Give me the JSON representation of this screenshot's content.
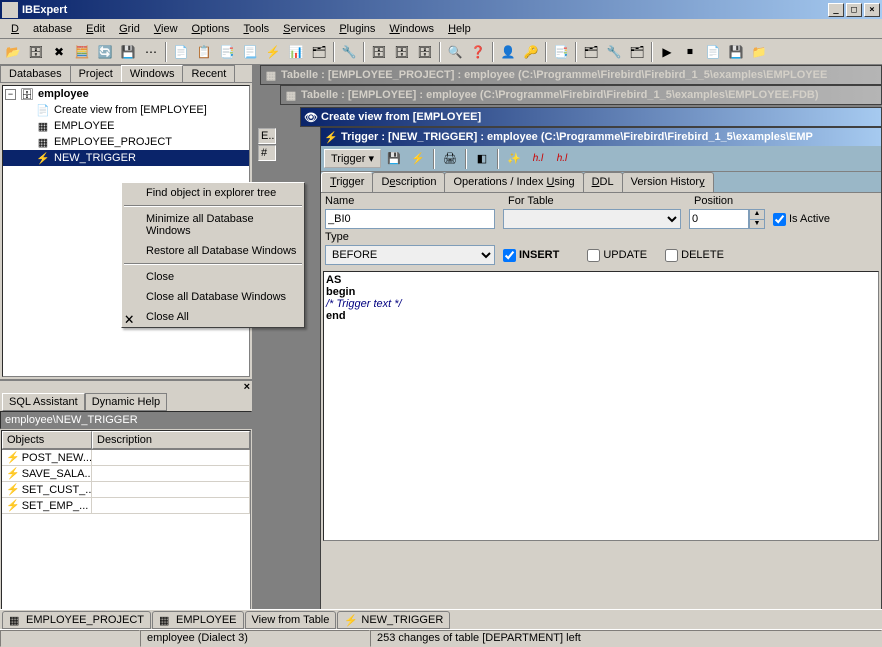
{
  "app": {
    "title": "IBExpert"
  },
  "menu": [
    "Database",
    "Edit",
    "Grid",
    "View",
    "Options",
    "Tools",
    "Services",
    "Plugins",
    "Windows",
    "Help"
  ],
  "left_tabs": [
    "Databases",
    "Project",
    "Windows",
    "Recent"
  ],
  "left_tab_active": 2,
  "tree": {
    "root": "employee",
    "items": [
      "Create view from [EMPLOYEE]",
      "EMPLOYEE",
      "EMPLOYEE_PROJECT",
      "NEW_TRIGGER"
    ],
    "selected": 3
  },
  "ctx": {
    "items": [
      "Find object in explorer tree",
      "-",
      "Minimize all Database Windows",
      "Restore all Database Windows",
      "-",
      "Close",
      "Close all Database Windows",
      "Close All"
    ]
  },
  "sql": {
    "tabs": [
      "SQL Assistant",
      "Dynamic Help"
    ],
    "path": "employee\\NEW_TRIGGER",
    "cols": [
      "Objects",
      "Description"
    ],
    "rows": [
      "POST_NEW...",
      "SAVE_SALA...",
      "SET_CUST_...",
      "SET_EMP_..."
    ]
  },
  "mdi": {
    "w1": "Tabelle : [EMPLOYEE_PROJECT] : employee (C:\\Programme\\Firebird\\Firebird_1_5\\examples\\EMPLOYEE",
    "w2": "Tabelle : [EMPLOYEE] : employee (C:\\Programme\\Firebird\\Firebird_1_5\\examples\\EMPLOYEE.FDB)",
    "w3": "Create view from [EMPLOYEE]",
    "w4": "Trigger : [NEW_TRIGGER] : employee (C:\\Programme\\Firebird\\Firebird_1_5\\examples\\EMP"
  },
  "trigger": {
    "menu": "Trigger",
    "tabs": [
      "Trigger",
      "Description",
      "Operations / Index Using",
      "DDL",
      "Version History"
    ],
    "labels": {
      "name": "Name",
      "fortable": "For Table",
      "position": "Position",
      "isactive": "Is Active",
      "type": "Type"
    },
    "name": "_BI0",
    "fortable": "",
    "position": "0",
    "type": "BEFORE",
    "ops": {
      "insert": "INSERT",
      "update": "UPDATE",
      "delete": "DELETE"
    },
    "insert_checked": true,
    "code": [
      "AS",
      "begin",
      "  /* Trigger text */",
      "end"
    ]
  },
  "bottom_tabs": [
    "EMPLOYEE_PROJECT",
    "EMPLOYEE",
    "View from Table",
    "NEW_TRIGGER"
  ],
  "status": {
    "s1": "employee (Dialect 3)",
    "s2": "253 changes of table [DEPARTMENT] left"
  }
}
